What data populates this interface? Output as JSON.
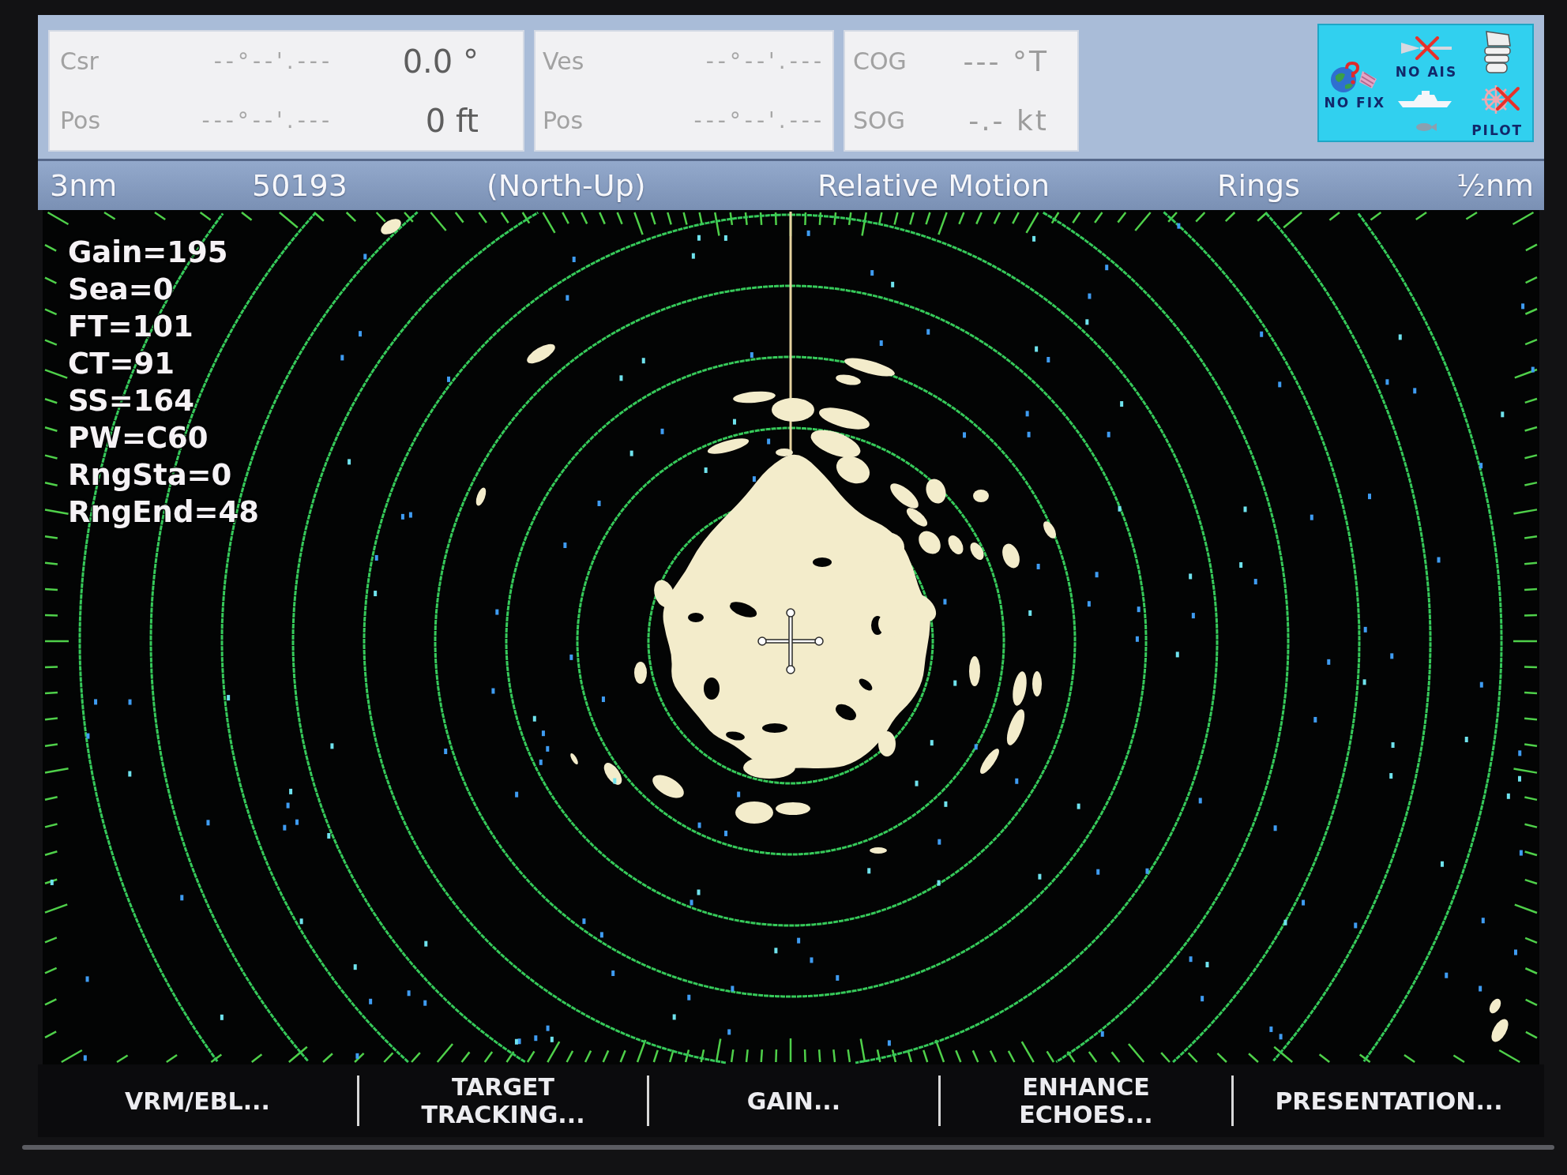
{
  "nav_panels": [
    {
      "rows": [
        {
          "label": "Csr",
          "coordinate": "--°--'.---",
          "value": "0.0 °"
        },
        {
          "label": "Pos",
          "coordinate": "---°--'.---",
          "value": "0 ft"
        }
      ]
    },
    {
      "rows": [
        {
          "label": "Ves",
          "coordinate": "--°--'.---"
        },
        {
          "label": "Pos",
          "coordinate": "---°--'.---"
        }
      ]
    },
    {
      "rows": [
        {
          "label": "COG",
          "value": "--- °T"
        },
        {
          "label": "SOG",
          "value": "-.- kt"
        }
      ]
    }
  ],
  "status_indicators": [
    {
      "kind": "gps",
      "label": "NO FIX"
    },
    {
      "kind": "ais",
      "label": "NO AIS",
      "crossed": true
    },
    {
      "kind": "autopilot",
      "label": "PILOT",
      "crossed": true
    }
  ],
  "header_bar": {
    "range": "3nm",
    "number": "50193",
    "orientation": "(North-Up)",
    "motion_mode": "Relative Motion",
    "rings": "Rings",
    "ring_interval": "½nm"
  },
  "radar_settings": [
    "Gain=195",
    "Sea=0",
    "FT=101",
    "CT=91",
    "SS=164",
    "PW=C60",
    "RngSta=0",
    "RngEnd=48"
  ],
  "softkeys": [
    "VRM/EBL...",
    "TARGET\nTRACKING...",
    "GAIN...",
    "ENHANCE\nECHOES...",
    "PRESENTATION..."
  ]
}
